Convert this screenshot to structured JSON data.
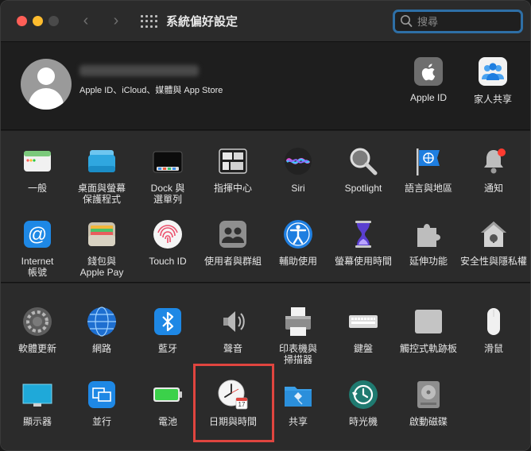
{
  "window": {
    "title": "系統偏好設定",
    "search": {
      "value": "",
      "placeholder": "搜尋"
    }
  },
  "account": {
    "subtitle": "Apple ID、iCloud、媒體與 App Store",
    "items": [
      {
        "label": "Apple ID",
        "icon": "apple-icon"
      },
      {
        "label": "家人共享",
        "icon": "family-icon"
      }
    ]
  },
  "section1": {
    "row1": [
      {
        "label": "一般",
        "icon": "general-icon"
      },
      {
        "label": "桌面與螢幕\n保護程式",
        "icon": "desktop-screensaver-icon"
      },
      {
        "label": "Dock 與\n選單列",
        "icon": "dock-icon"
      },
      {
        "label": "指揮中心",
        "icon": "mission-control-icon"
      },
      {
        "label": "Siri",
        "icon": "siri-icon"
      },
      {
        "label": "Spotlight",
        "icon": "spotlight-icon"
      },
      {
        "label": "語言與地區",
        "icon": "language-region-icon"
      },
      {
        "label": "通知",
        "icon": "notifications-icon"
      }
    ],
    "row2": [
      {
        "label": "Internet\n帳號",
        "icon": "internet-accounts-icon"
      },
      {
        "label": "錢包與\nApple Pay",
        "icon": "wallet-icon"
      },
      {
        "label": "Touch ID",
        "icon": "touch-id-icon"
      },
      {
        "label": "使用者與群組",
        "icon": "users-groups-icon"
      },
      {
        "label": "輔助使用",
        "icon": "accessibility-icon"
      },
      {
        "label": "螢幕使用時間",
        "icon": "screen-time-icon"
      },
      {
        "label": "延伸功能",
        "icon": "extensions-icon"
      },
      {
        "label": "安全性與隱私權",
        "icon": "security-privacy-icon"
      }
    ]
  },
  "section2": {
    "row1": [
      {
        "label": "軟體更新",
        "icon": "software-update-icon"
      },
      {
        "label": "網路",
        "icon": "network-icon"
      },
      {
        "label": "藍牙",
        "icon": "bluetooth-icon"
      },
      {
        "label": "聲音",
        "icon": "sound-icon"
      },
      {
        "label": "印表機與\n掃描器",
        "icon": "printers-icon"
      },
      {
        "label": "鍵盤",
        "icon": "keyboard-icon"
      },
      {
        "label": "觸控式軌跡板",
        "icon": "trackpad-icon"
      },
      {
        "label": "滑鼠",
        "icon": "mouse-icon"
      }
    ],
    "row2": [
      {
        "label": "顯示器",
        "icon": "displays-icon"
      },
      {
        "label": "並行",
        "icon": "sidecar-icon"
      },
      {
        "label": "電池",
        "icon": "battery-icon"
      },
      {
        "label": "日期與時間",
        "icon": "date-time-icon"
      },
      {
        "label": "共享",
        "icon": "sharing-icon"
      },
      {
        "label": "時光機",
        "icon": "time-machine-icon"
      },
      {
        "label": "啟動磁碟",
        "icon": "startup-disk-icon"
      }
    ]
  },
  "calendar_day": "17",
  "colors": {
    "highlight": "#e0453f",
    "search_focus": "#2e6fa6",
    "accent_blue": "#1e88e5"
  }
}
